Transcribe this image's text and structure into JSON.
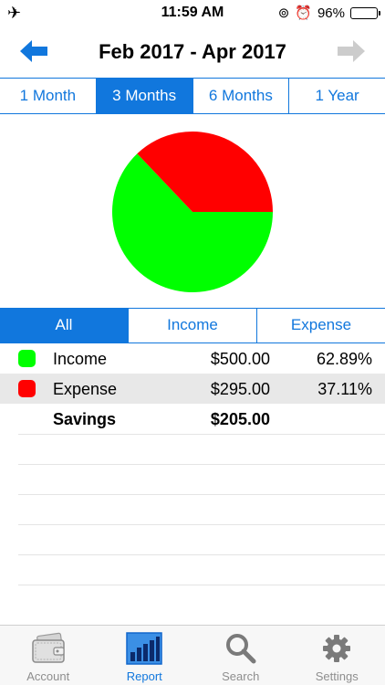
{
  "status": {
    "time": "11:59 AM",
    "battery": "96%",
    "battery_level": 0.96
  },
  "nav": {
    "title": "Feb 2017 - Apr 2017",
    "prev_icon": "arrow-left-icon",
    "next_icon": "arrow-right-icon"
  },
  "period_tabs": [
    {
      "label": "1 Month",
      "active": false
    },
    {
      "label": "3 Months",
      "active": true
    },
    {
      "label": "6 Months",
      "active": false
    },
    {
      "label": "1 Year",
      "active": false
    }
  ],
  "chart_data": {
    "type": "pie",
    "slices": [
      {
        "label": "Income",
        "value": 500.0,
        "percent": 62.89,
        "color": "#00ff00"
      },
      {
        "label": "Expense",
        "value": 295.0,
        "percent": 37.11,
        "color": "#ff0000"
      }
    ]
  },
  "type_tabs": [
    {
      "label": "All",
      "active": true
    },
    {
      "label": "Income",
      "active": false
    },
    {
      "label": "Expense",
      "active": false
    }
  ],
  "summary": {
    "rows": [
      {
        "name": "Income",
        "amount": "$500.00",
        "percent": "62.89%",
        "color": "#00ff00"
      },
      {
        "name": "Expense",
        "amount": "$295.00",
        "percent": "37.11%",
        "color": "#ff0000"
      }
    ],
    "savings": {
      "name": "Savings",
      "amount": "$205.00"
    }
  },
  "tabbar": [
    {
      "label": "Account",
      "icon": "wallet-icon",
      "active": false
    },
    {
      "label": "Report",
      "icon": "bar-chart-icon",
      "active": true
    },
    {
      "label": "Search",
      "icon": "search-icon",
      "active": false
    },
    {
      "label": "Settings",
      "icon": "gear-icon",
      "active": false
    }
  ],
  "colors": {
    "accent": "#1177dd",
    "income": "#00ff00",
    "expense": "#ff0000"
  }
}
